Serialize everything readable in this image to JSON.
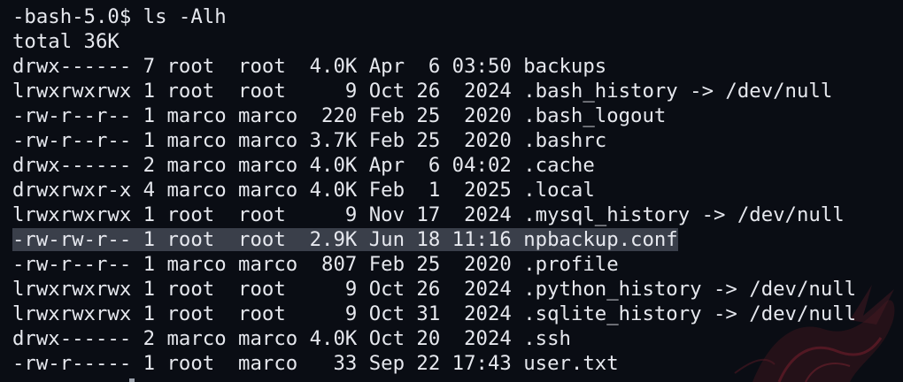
{
  "terminal": {
    "lines": [
      "-bash-5.0$ ls -Alh",
      "total 36K",
      "drwx------ 7 root  root  4.0K Apr  6 03:50 backups",
      "lrwxrwxrwx 1 root  root     9 Oct 26  2024 .bash_history -> /dev/null",
      "-rw-r--r-- 1 marco marco  220 Feb 25  2020 .bash_logout",
      "-rw-r--r-- 1 marco marco 3.7K Feb 25  2020 .bashrc",
      "drwx------ 2 marco marco 4.0K Apr  6 04:02 .cache",
      "drwxrwxr-x 4 marco marco 4.0K Feb  1  2025 .local",
      "lrwxrwxrwx 1 root  root     9 Nov 17  2024 .mysql_history -> /dev/null",
      "-rw-rw-r-- 1 root  root  2.9K Jun 18 11:16 npbackup.conf",
      "-rw-r--r-- 1 marco marco  807 Feb 25  2020 .profile",
      "lrwxrwxrwx 1 root  root     9 Oct 26  2024 .python_history -> /dev/null",
      "lrwxrwxrwx 1 root  root     9 Oct 31  2024 .sqlite_history -> /dev/null",
      "drwx------ 2 marco marco 4.0K Oct 20  2024 .ssh",
      "-rw-r----- 1 root  marco   33 Sep 22 17:43 user.txt"
    ],
    "highlighted_line_index": 9
  },
  "colors": {
    "background": "#0a0d14",
    "text": "#e6e8ee",
    "highlight": "#3a3f4a",
    "watermark": "#8a1f2a"
  }
}
